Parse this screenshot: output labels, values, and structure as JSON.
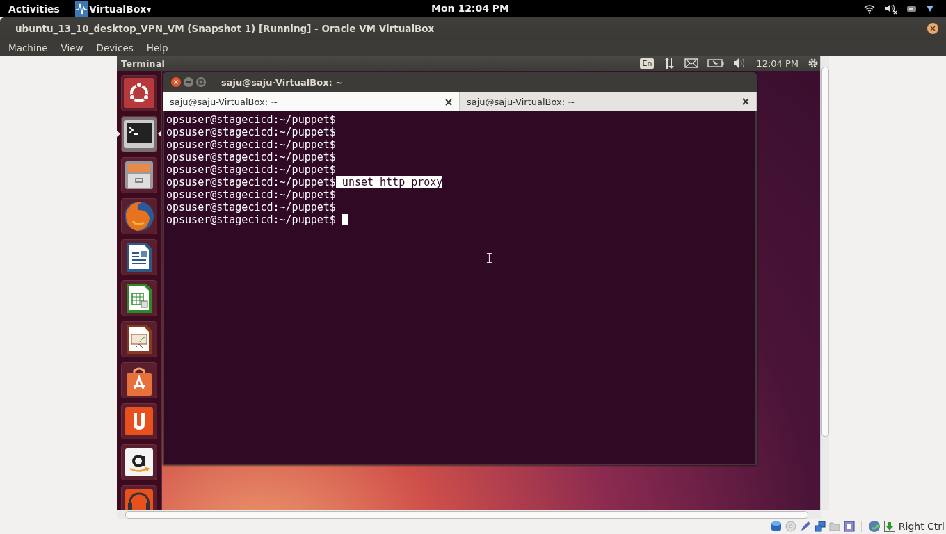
{
  "top_bar": {
    "activities": "Activities",
    "app_menu": "VirtualBox▾",
    "clock": "Mon 12:04 PM"
  },
  "window": {
    "title": "ubuntu_13_10_desktop_VPN_VM (Snapshot 1) [Running] - Oracle VM VirtualBox"
  },
  "menu": [
    "Machine",
    "View",
    "Devices",
    "Help"
  ],
  "guest": {
    "panel": {
      "app_title": "Terminal",
      "keyboard": "En",
      "clock": "12:04 PM"
    },
    "launcher": [
      {
        "kind": "dash",
        "selected": false
      },
      {
        "kind": "terminal",
        "selected": true
      },
      {
        "kind": "files",
        "selected": false
      },
      {
        "kind": "browser",
        "selected": false
      },
      {
        "kind": "writer",
        "selected": false
      },
      {
        "kind": "calc",
        "selected": false
      },
      {
        "kind": "impress",
        "selected": false
      },
      {
        "kind": "software",
        "selected": false
      },
      {
        "kind": "one",
        "selected": false
      },
      {
        "kind": "amazon",
        "selected": false
      },
      {
        "kind": "music",
        "selected": false
      }
    ],
    "terminal": {
      "title": "saju@saju-VirtualBox: ~",
      "tabs": [
        {
          "label": "saju@saju-VirtualBox: ~",
          "selected": true
        },
        {
          "label": "saju@saju-VirtualBox: ~",
          "selected": false
        }
      ],
      "lines": [
        {
          "prompt": "opsuser@stagecicd:~/puppet$",
          "cursor": false
        },
        {
          "prompt": "opsuser@stagecicd:~/puppet$",
          "cursor": false
        },
        {
          "prompt": "opsuser@stagecicd:~/puppet$",
          "cursor": false
        },
        {
          "prompt": "opsuser@stagecicd:~/puppet$",
          "cursor": false
        },
        {
          "prompt": "opsuser@stagecicd:~/puppet$",
          "cursor": false
        },
        {
          "prompt": "opsuser@stagecicd:~/puppet$",
          "command": "unset http_proxy",
          "highlighted": true,
          "cursor": false
        },
        {
          "prompt": "opsuser@stagecicd:~/puppet$",
          "cursor": false
        },
        {
          "prompt": "opsuser@stagecicd:~/puppet$",
          "cursor": false
        },
        {
          "prompt": "opsuser@stagecicd:~/puppet$",
          "cursor": true
        }
      ]
    }
  },
  "status_bar": {
    "host_key": "Right Ctrl"
  }
}
